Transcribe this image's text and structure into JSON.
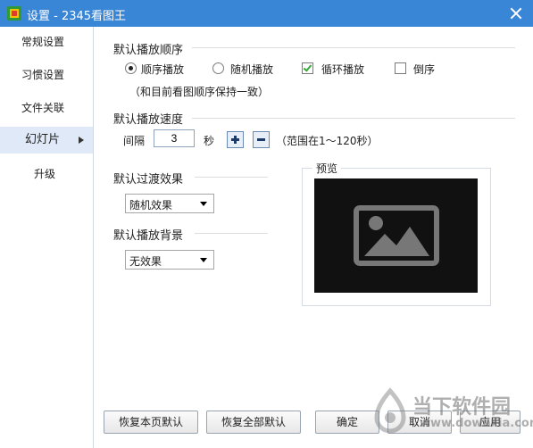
{
  "window": {
    "title": "设置 - 2345看图王"
  },
  "sidebar": {
    "items": [
      {
        "label": "常规设置"
      },
      {
        "label": "习惯设置"
      },
      {
        "label": "文件关联"
      },
      {
        "label": "幻灯片",
        "active": true
      },
      {
        "label": "升级"
      }
    ]
  },
  "order": {
    "title": "默认播放顺序",
    "options": [
      {
        "label": "顺序播放",
        "selected": true
      },
      {
        "label": "随机播放",
        "selected": false
      }
    ],
    "loop": {
      "label": "循环播放",
      "checked": true
    },
    "reverse": {
      "label": "倒序",
      "checked": false
    },
    "note": "（和目前看图顺序保持一致）"
  },
  "speed": {
    "title": "默认播放速度",
    "interval_label": "间隔",
    "value": "3",
    "unit": "秒",
    "range_note": "（范围在1～120秒）"
  },
  "transition": {
    "title": "默认过渡效果",
    "selected": "随机效果"
  },
  "background": {
    "title": "默认播放背景",
    "selected": "无效果"
  },
  "preview": {
    "label": "预览"
  },
  "footer": {
    "restore_page": "恢复本页默认",
    "restore_all": "恢复全部默认",
    "ok": "确定",
    "cancel": "取消",
    "apply": "应用"
  },
  "watermark": {
    "text": "当下软件园",
    "url": "www.downxia.com"
  }
}
